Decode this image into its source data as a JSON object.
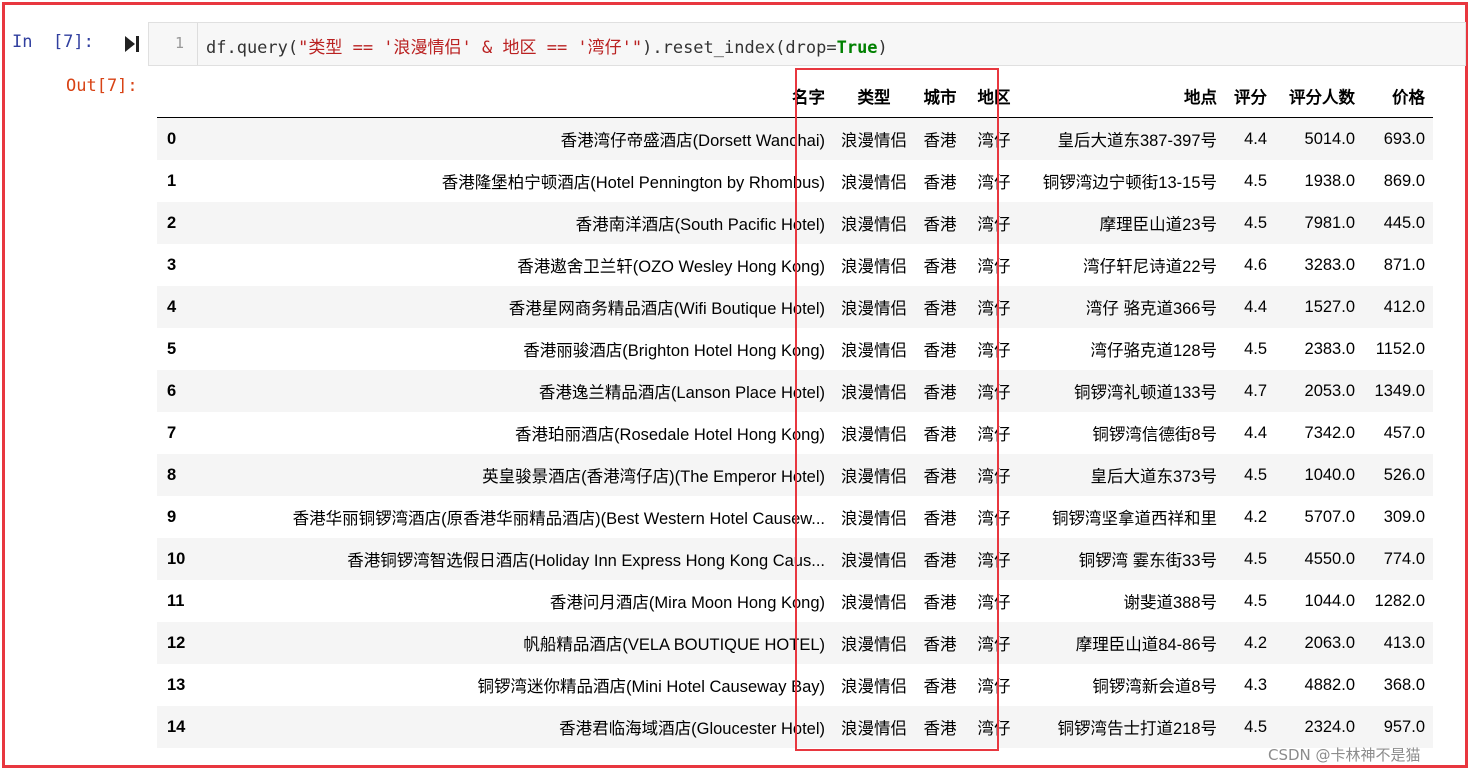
{
  "cell": {
    "in_prompt": "In  [7]:",
    "out_prompt": "Out[7]:",
    "line_number": "1",
    "code": {
      "part1": "df.query(",
      "string": "\"类型 == '浪漫情侣' & 地区 == '湾仔'\"",
      "part2": ").reset_index(drop=",
      "keyword": "True",
      "part3": ")"
    }
  },
  "table": {
    "headers": [
      "",
      "名字",
      "类型",
      "城市",
      "地区",
      "地点",
      "评分",
      "评分人数",
      "价格"
    ],
    "rows": [
      [
        "0",
        "香港湾仔帝盛酒店(Dorsett Wanchai)",
        "浪漫情侣",
        "香港",
        "湾仔",
        "皇后大道东387-397号",
        "4.4",
        "5014.0",
        "693.0"
      ],
      [
        "1",
        "香港隆堡柏宁顿酒店(Hotel Pennington by Rhombus)",
        "浪漫情侣",
        "香港",
        "湾仔",
        "铜锣湾边宁顿街13-15号",
        "4.5",
        "1938.0",
        "869.0"
      ],
      [
        "2",
        "香港南洋酒店(South Pacific Hotel)",
        "浪漫情侣",
        "香港",
        "湾仔",
        "摩理臣山道23号",
        "4.5",
        "7981.0",
        "445.0"
      ],
      [
        "3",
        "香港遨舍卫兰轩(OZO Wesley Hong Kong)",
        "浪漫情侣",
        "香港",
        "湾仔",
        "湾仔轩尼诗道22号",
        "4.6",
        "3283.0",
        "871.0"
      ],
      [
        "4",
        "香港星网商务精品酒店(Wifi Boutique Hotel)",
        "浪漫情侣",
        "香港",
        "湾仔",
        "湾仔 骆克道366号",
        "4.4",
        "1527.0",
        "412.0"
      ],
      [
        "5",
        "香港丽骏酒店(Brighton Hotel Hong Kong)",
        "浪漫情侣",
        "香港",
        "湾仔",
        "湾仔骆克道128号",
        "4.5",
        "2383.0",
        "1152.0"
      ],
      [
        "6",
        "香港逸兰精品酒店(Lanson Place Hotel)",
        "浪漫情侣",
        "香港",
        "湾仔",
        "铜锣湾礼顿道133号",
        "4.7",
        "2053.0",
        "1349.0"
      ],
      [
        "7",
        "香港珀丽酒店(Rosedale Hotel Hong Kong)",
        "浪漫情侣",
        "香港",
        "湾仔",
        "铜锣湾信德街8号",
        "4.4",
        "7342.0",
        "457.0"
      ],
      [
        "8",
        "英皇骏景酒店(香港湾仔店)(The Emperor Hotel)",
        "浪漫情侣",
        "香港",
        "湾仔",
        "皇后大道东373号",
        "4.5",
        "1040.0",
        "526.0"
      ],
      [
        "9",
        "香港华丽铜锣湾酒店(原香港华丽精品酒店)(Best Western Hotel Causew...",
        "浪漫情侣",
        "香港",
        "湾仔",
        "铜锣湾坚拿道西祥和里",
        "4.2",
        "5707.0",
        "309.0"
      ],
      [
        "10",
        "香港铜锣湾智选假日酒店(Holiday Inn Express Hong Kong Caus...",
        "浪漫情侣",
        "香港",
        "湾仔",
        "铜锣湾 霎东街33号",
        "4.5",
        "4550.0",
        "774.0"
      ],
      [
        "11",
        "香港问月酒店(Mira Moon Hong Kong)",
        "浪漫情侣",
        "香港",
        "湾仔",
        "谢斐道388号",
        "4.5",
        "1044.0",
        "1282.0"
      ],
      [
        "12",
        "帆船精品酒店(VELA BOUTIQUE HOTEL)",
        "浪漫情侣",
        "香港",
        "湾仔",
        "摩理臣山道84-86号",
        "4.2",
        "2063.0",
        "413.0"
      ],
      [
        "13",
        "铜锣湾迷你精品酒店(Mini Hotel Causeway Bay)",
        "浪漫情侣",
        "香港",
        "湾仔",
        "铜锣湾新会道8号",
        "4.3",
        "4882.0",
        "368.0"
      ],
      [
        "14",
        "香港君临海域酒店(Gloucester Hotel)",
        "浪漫情侣",
        "香港",
        "湾仔",
        "铜锣湾告士打道218号",
        "4.5",
        "2324.0",
        "957.0"
      ]
    ]
  },
  "watermark": "CSDN @卡林神不是猫",
  "colors": {
    "highlight": "#e8373f",
    "string": "#ba2121",
    "keyword": "#008000",
    "in_prompt": "#303f9f",
    "out_prompt": "#d84315"
  }
}
